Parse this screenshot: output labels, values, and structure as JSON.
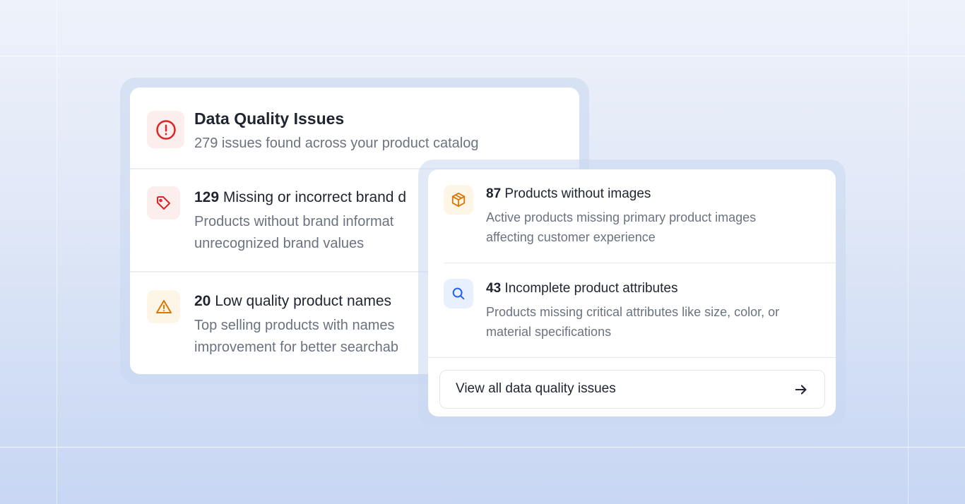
{
  "summary_card": {
    "title": "Data Quality Issues",
    "subtitle": "279 issues found across your product catalog",
    "icon": "alert-circle-icon",
    "accent": "#dc2626",
    "items": [
      {
        "count": "129",
        "title": "Missing or incorrect brand d",
        "description_line1": "Products without brand informat",
        "description_line2": "unrecognized brand values",
        "icon": "tag-icon",
        "accent": "#dc2626"
      },
      {
        "count": "20",
        "title": "Low quality product names",
        "description_line1": "Top selling products with names",
        "description_line2": "improvement for better searchab",
        "icon": "warning-triangle-icon",
        "accent": "#d97706"
      }
    ]
  },
  "detail_card": {
    "items": [
      {
        "count": "87",
        "title": "Products without images",
        "description_line1": "Active products missing primary product images",
        "description_line2": "affecting customer experience",
        "icon": "package-icon",
        "accent": "#d97706"
      },
      {
        "count": "43",
        "title": "Incomplete product attributes",
        "description_line1": "Products missing critical attributes like size, color, or",
        "description_line2": "material specifications",
        "icon": "search-icon",
        "accent": "#2563eb"
      }
    ],
    "view_all_label": "View all data quality issues",
    "view_all_icon": "arrow-right-icon"
  }
}
